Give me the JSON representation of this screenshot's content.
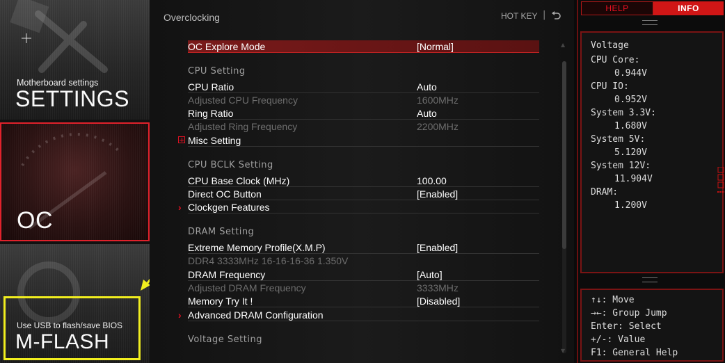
{
  "nav": {
    "settings": {
      "subtitle": "Motherboard settings",
      "title": "SETTINGS"
    },
    "oc": {
      "title": "OC"
    },
    "mflash": {
      "subtitle": "Use USB to flash/save BIOS",
      "title": "M-FLASH"
    }
  },
  "header": {
    "title": "Overclocking",
    "hotkey_label": "HOT KEY",
    "separator": "|"
  },
  "settings_list": {
    "oc_explore_mode": {
      "label": "OC Explore Mode",
      "value": "[Normal]"
    },
    "cpu_setting_heading": "CPU  Setting",
    "cpu_ratio": {
      "label": "CPU Ratio",
      "value": "Auto"
    },
    "adjusted_cpu_freq": {
      "label": "Adjusted CPU Frequency",
      "value": "1600MHz"
    },
    "ring_ratio": {
      "label": "Ring Ratio",
      "value": "Auto"
    },
    "adjusted_ring_freq": {
      "label": "Adjusted Ring Frequency",
      "value": "2200MHz"
    },
    "misc_setting": {
      "label": "Misc Setting"
    },
    "cpu_bclk_heading": "CPU  BCLK  Setting",
    "cpu_base_clock": {
      "label": "CPU Base Clock (MHz)",
      "value": "100.00"
    },
    "direct_oc_button": {
      "label": "Direct OC Button",
      "value": "[Enabled]"
    },
    "clockgen_features": {
      "label": "Clockgen Features"
    },
    "dram_heading": "DRAM  Setting",
    "xmp": {
      "label": "Extreme Memory Profile(X.M.P)",
      "value": "[Enabled]"
    },
    "xmp_info": {
      "label": "DDR4 3333MHz 16-16-16-36 1.350V"
    },
    "dram_frequency": {
      "label": "DRAM Frequency",
      "value": "[Auto]"
    },
    "adjusted_dram_freq": {
      "label": "Adjusted DRAM Frequency",
      "value": "3333MHz"
    },
    "memory_try_it": {
      "label": "Memory Try It !",
      "value": "[Disabled]"
    },
    "advanced_dram": {
      "label": "Advanced DRAM Configuration"
    },
    "voltage_heading": "Voltage  Setting"
  },
  "right_panel": {
    "tabs": {
      "help": "HELP",
      "info": "INFO"
    },
    "info_title": "Voltage",
    "voltages": [
      {
        "label": "CPU Core:",
        "value": "0.944V"
      },
      {
        "label": "CPU IO:",
        "value": "0.952V"
      },
      {
        "label": "System 3.3V:",
        "value": "1.680V"
      },
      {
        "label": "System 5V:",
        "value": "5.120V"
      },
      {
        "label": "System 12V:",
        "value": "11.904V"
      },
      {
        "label": "DRAM:",
        "value": "1.200V"
      }
    ],
    "keys": [
      "↑↓: Move",
      "→←: Group Jump",
      "Enter: Select",
      "+/-: Value",
      "F1: General Help"
    ]
  },
  "colors": {
    "accent_red": "#d01616",
    "highlight_yellow": "#f1ee1f"
  },
  "icons": {
    "back": "back-icon",
    "cursor": "crosshair-cursor-icon",
    "arrow": "yellow-arrow-annotation"
  }
}
